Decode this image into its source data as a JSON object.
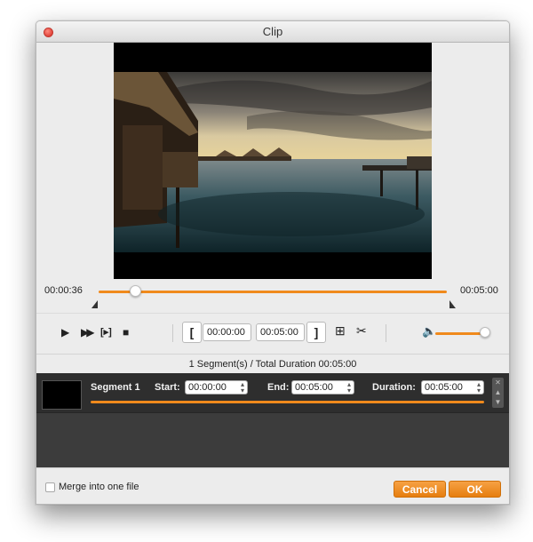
{
  "window": {
    "title": "Clip"
  },
  "timeline": {
    "current_time": "00:00:36",
    "total_time": "00:05:00",
    "progress": 0.12
  },
  "controls": {
    "start_time": "00:00:00",
    "end_time": "00:05:00",
    "volume_level": 0.95
  },
  "summary": "1 Segment(s) / Total Duration 00:05:00",
  "segments": [
    {
      "name": "Segment 1",
      "start_label": "Start:",
      "start_value": "00:00:00",
      "end_label": "End:",
      "end_value": "00:05:00",
      "duration_label": "Duration:",
      "duration_value": "00:05:00"
    }
  ],
  "footer": {
    "merge_label": "Merge into one file",
    "merge_checked": false,
    "cancel_label": "Cancel",
    "ok_label": "OK"
  },
  "colors": {
    "accent": "#f08a1c",
    "segment_bg": "#3c3c3c",
    "close": "#e0443a"
  }
}
